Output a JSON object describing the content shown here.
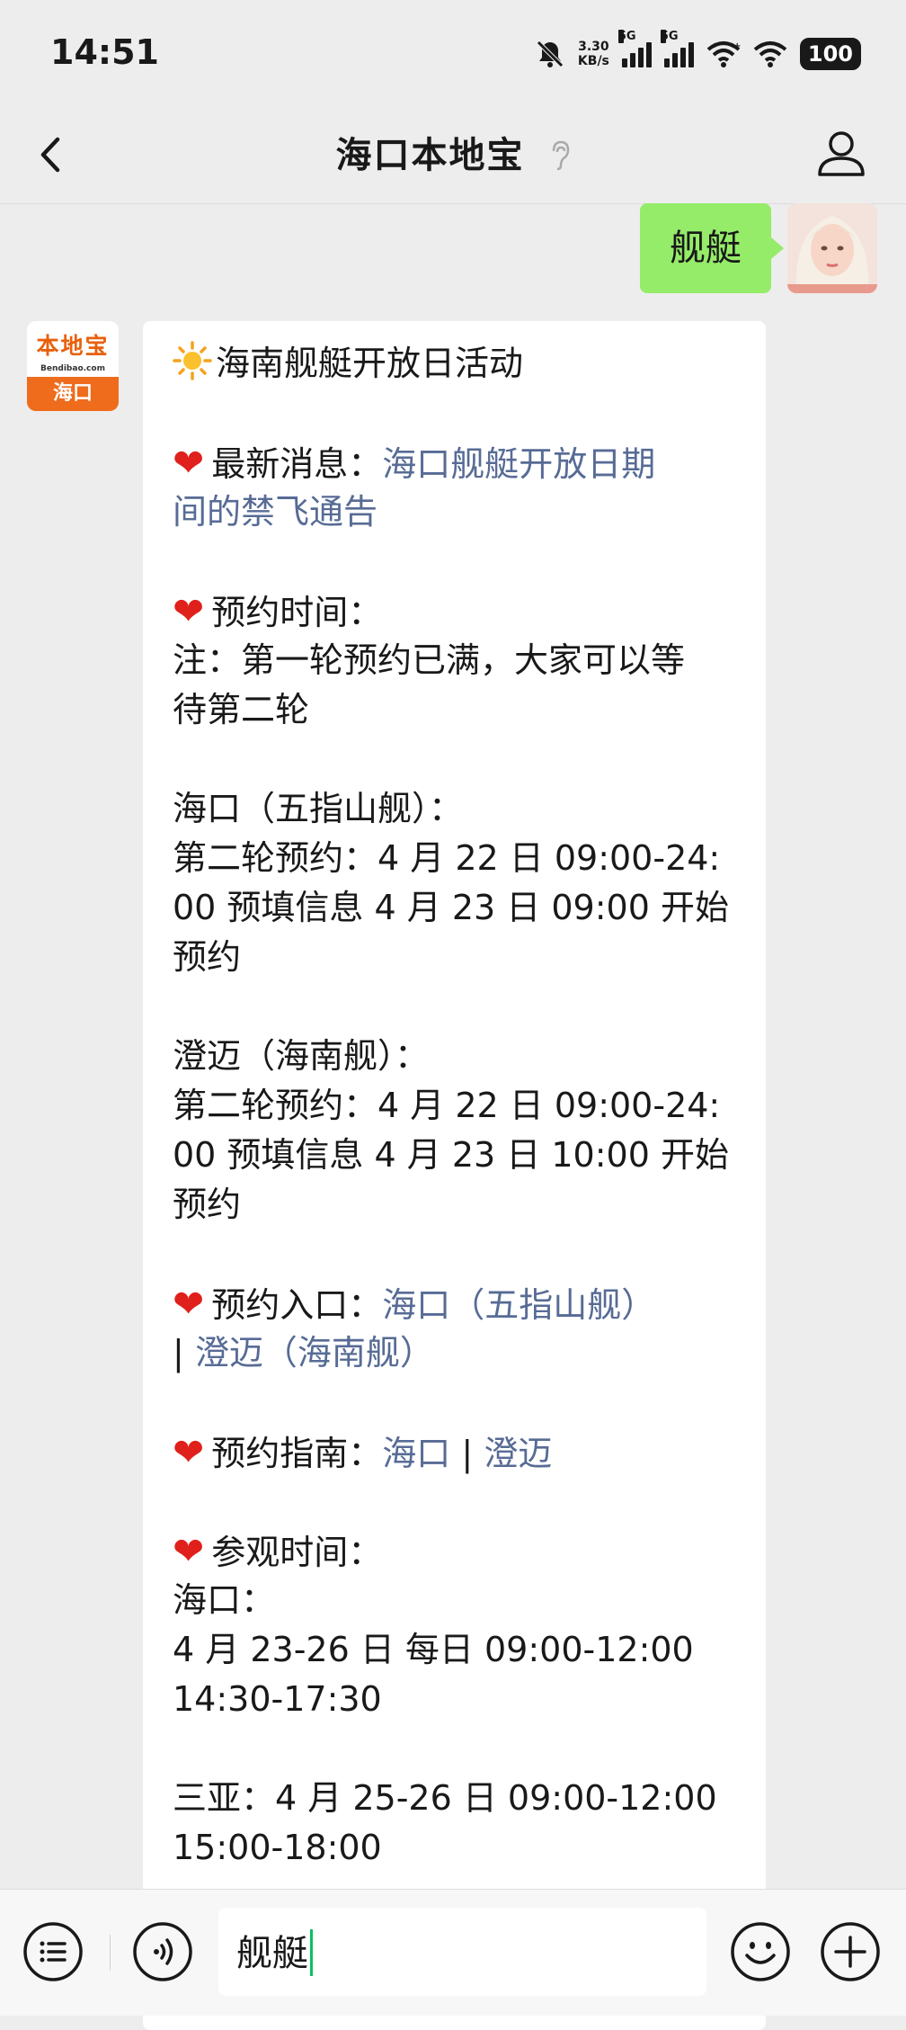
{
  "status_bar": {
    "time": "14:51",
    "net_speed_value": "3.30",
    "net_speed_unit": "KB/s",
    "sim1": "5G",
    "sim2": "5G",
    "battery": "100"
  },
  "header": {
    "title": "海口本地宝"
  },
  "chat": {
    "sent_message": "舰艇",
    "bot_avatar": {
      "logo_text": "本地宝",
      "logo_url": "Bendibao.com",
      "city": "海口"
    },
    "reply": {
      "title": "海南舰艇开放日活动",
      "news_label": "最新消息：",
      "news_link_line1": "海口舰艇开放日期",
      "news_link_line2": "间的禁飞通告",
      "booking_time_label": "预约时间：",
      "note_line1": "注：第一轮预约已满，大家可以等",
      "note_line2": "待第二轮",
      "haikou_heading": "海口（五指山舰）：",
      "haikou_line1": "第二轮预约：4 月 22 日 09:00-24:",
      "haikou_line2": "00 预填信息 4 月 23 日 09:00 开始",
      "haikou_line3": "预约",
      "chengmai_heading": "澄迈（海南舰）：",
      "chengmai_line1": "第二轮预约：4 月 22 日 09:00-24:",
      "chengmai_line2": "00 预填信息 4 月 23 日 10:00 开始",
      "chengmai_line3": "预约",
      "entry_label": "预约入口：",
      "entry_link1": "海口（五指山舰）",
      "separator": "|",
      "entry_link2": "澄迈（海南舰）",
      "guide_label": "预约指南：",
      "guide_link1": "海口",
      "guide_link2": "澄迈",
      "visit_time_label": "参观时间：",
      "visit_haikou_label": "海口：",
      "visit_haikou_line1": "4 月 23-26 日 每日 09:00-12:00",
      "visit_haikou_line2": "14:30-17:30",
      "visit_sanya_line1": "三亚：4 月 25-26 日 09:00-12:00",
      "visit_sanya_line2": "15:00-18:00"
    }
  },
  "input": {
    "text": "舰艇"
  },
  "colors": {
    "background": "#ededed",
    "sent_bubble": "#95ec69",
    "link": "#576b95",
    "heart": "#e0201b",
    "caret": "#07c160"
  }
}
